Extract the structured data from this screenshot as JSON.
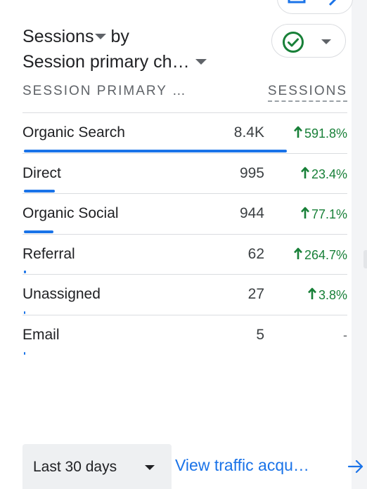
{
  "card": {
    "title_metric": "Sessions",
    "title_by": "by",
    "title_dimension": "Session primary ch…"
  },
  "comparison": {
    "icon": "check-circle-icon",
    "status_color": "#188038"
  },
  "table": {
    "dimension_header": "SESSION PRIMARY …",
    "metric_header": "SESSIONS",
    "rows": [
      {
        "label": "Organic Search",
        "value": "8.4K",
        "change": "591.8%",
        "trend": "up",
        "share": 0.81
      },
      {
        "label": "Direct",
        "value": "995",
        "change": "23.4%",
        "trend": "up",
        "share": 0.095
      },
      {
        "label": "Organic Social",
        "value": "944",
        "change": "77.1%",
        "trend": "up",
        "share": 0.09
      },
      {
        "label": "Referral",
        "value": "62",
        "change": "264.7%",
        "trend": "up",
        "share": 0.006
      },
      {
        "label": "Unassigned",
        "value": "27",
        "change": "3.8%",
        "trend": "up",
        "share": 0.003
      },
      {
        "label": "Email",
        "value": "5",
        "change": "-",
        "trend": "none",
        "share": 0.001
      }
    ]
  },
  "footer": {
    "date_range": "Last 30 days",
    "link_text": "View traffic acqu…"
  },
  "colors": {
    "accent": "#1a73e8",
    "positive": "#188038",
    "text": "#202124",
    "muted": "#5f6368"
  }
}
